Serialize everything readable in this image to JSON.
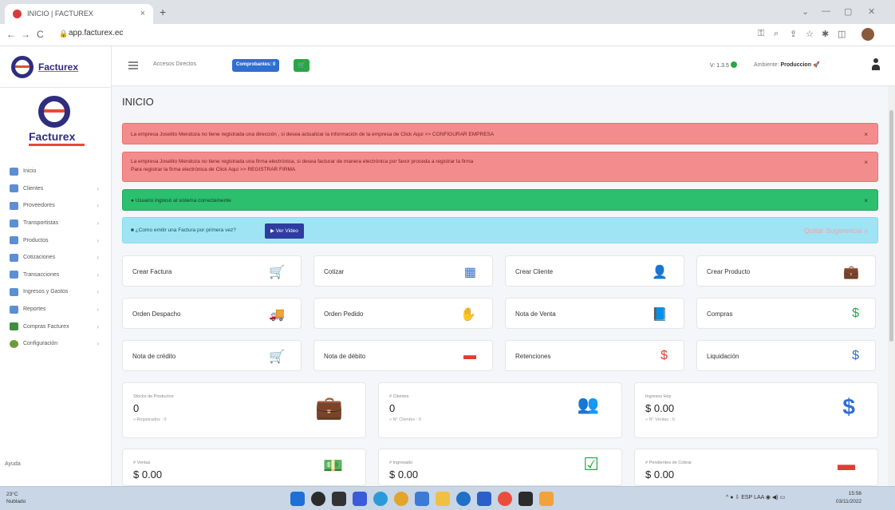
{
  "browser": {
    "tab_title": "INICIO | FACTUREX",
    "tab_close": "×",
    "new_tab": "+",
    "url": "app.facturex.ec",
    "back": "←",
    "forward": "→",
    "reload": "C",
    "lock": "🔒",
    "win_min": "—",
    "win_max": "▢",
    "win_close": "✕",
    "win_down": "⌄"
  },
  "brand": {
    "name": "Facturex",
    "big_name": "Facturex"
  },
  "topnav": {
    "accesos": "Accesos Directos",
    "comprobantes": "Comprobantes: 0",
    "cart": "🛒",
    "version": "V: 1.3.5",
    "ambiente_label": "Ambiente:",
    "ambiente_value": "Produccion",
    "ambiente_icon": "🚀"
  },
  "sidebar": {
    "items": [
      {
        "label": "Inicio",
        "chevron": ""
      },
      {
        "label": "Clientes",
        "chevron": "›"
      },
      {
        "label": "Proveedores",
        "chevron": "›"
      },
      {
        "label": "Transportistas",
        "chevron": "›"
      },
      {
        "label": "Productos",
        "chevron": "›"
      },
      {
        "label": "Cotizaciones",
        "chevron": "›"
      },
      {
        "label": "Transacciones",
        "chevron": "›"
      },
      {
        "label": "Ingresos y Gastos",
        "chevron": "›"
      },
      {
        "label": "Reportes",
        "chevron": "›"
      },
      {
        "label": "Compras Facturex",
        "chevron": "›"
      },
      {
        "label": "Configuración",
        "chevron": "›"
      }
    ],
    "ayuda": "Ayuda"
  },
  "page": {
    "title": "INICIO"
  },
  "alerts": {
    "a1": "La empresa Joselito Mendoza no tiene registrada una dirección , si desea actualizar la información de la empresa de Click Aqui >> CONFIGURAR EMPRESA",
    "a2_line1": "La empresa Joselito Mendoza no tiene registrada una firma electrónica, si desea facturar de manera electrónica por favor proceda a registrar la firma",
    "a2_line2": "Para registrar la firma electrónica de Click Aqui >> REGISTRAR FIRMA",
    "a3": "Usuario ingresó al sistema correctamente",
    "a4": "¿Como emitir una Factura por primera vez?",
    "video_btn": "▶ Ver Video",
    "quitar": "Quitar Sugerencia »",
    "close": "×"
  },
  "cards": [
    {
      "label": "Crear Factura",
      "icon": "🛒"
    },
    {
      "label": "Cotizar",
      "icon": "▦"
    },
    {
      "label": "Crear Cliente",
      "icon": "👤"
    },
    {
      "label": "Crear Producto",
      "icon": "💼"
    },
    {
      "label": "Orden Despacho",
      "icon": "🚚"
    },
    {
      "label": "Orden Pedido",
      "icon": "✋"
    },
    {
      "label": "Nota de Venta",
      "icon": "📘"
    },
    {
      "label": "Compras",
      "icon": "$"
    },
    {
      "label": "Nota de crédito",
      "icon": "🛒"
    },
    {
      "label": "Nota de débito",
      "icon": "▬"
    },
    {
      "label": "Retenciones",
      "icon": "$"
    },
    {
      "label": "Liquidación",
      "icon": "$"
    }
  ],
  "stats": [
    {
      "label": "Stocks de Productos",
      "value": "0",
      "sub": "» Registrados : 0",
      "icon": "💼"
    },
    {
      "label": "# Clientes",
      "value": "0",
      "sub": "» N° Clientes : 0",
      "icon": "👥"
    },
    {
      "label": "Ingresos Hoy",
      "value": "$ 0.00",
      "sub": "» N° Ventas : 0",
      "icon": "$"
    },
    {
      "label": "# Ventas",
      "value": "$ 0.00",
      "sub": "",
      "icon": "💵"
    },
    {
      "label": "# Ingresado",
      "value": "$ 0.00",
      "sub": "",
      "icon": "☑"
    },
    {
      "label": "# Pendientes de Cobrar",
      "value": "$ 0.00",
      "sub": "",
      "icon": "▬"
    }
  ],
  "taskbar": {
    "temp": "23°C",
    "weather": "Nublado",
    "lang": "ESP",
    "lang2": "LAA",
    "time": "15:56",
    "date": "03/11/2022"
  },
  "colors": {
    "danger": "#f38d8d",
    "success": "#2bbf6e",
    "info": "#9fe4f5",
    "primary": "#2f6fd1",
    "brand": "#2e2d7e"
  }
}
